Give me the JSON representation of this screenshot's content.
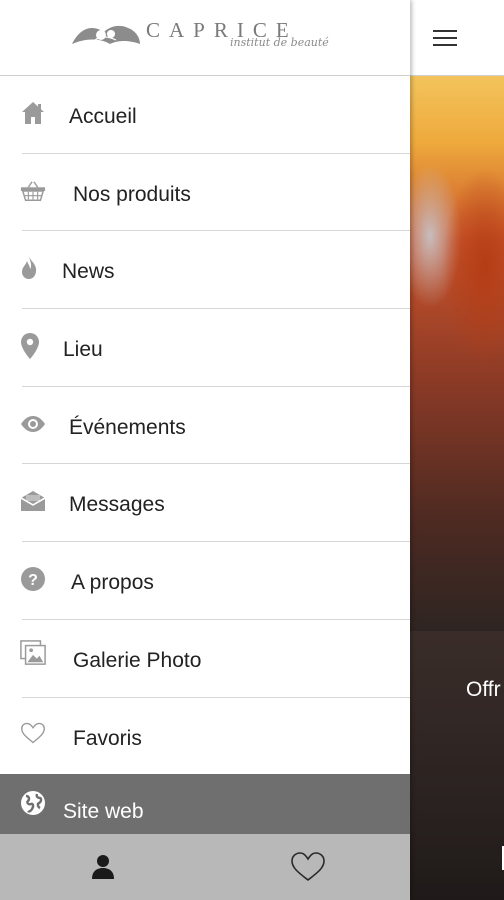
{
  "logo": {
    "name": "CAPRICE",
    "subtitle": "institut de beauté"
  },
  "menu": {
    "items": [
      {
        "label": "Accueil",
        "icon": "home-icon"
      },
      {
        "label": "Nos produits",
        "icon": "basket-icon"
      },
      {
        "label": "News",
        "icon": "flame-icon"
      },
      {
        "label": "Lieu",
        "icon": "location-pin-icon"
      },
      {
        "label": "Événements",
        "icon": "eye-icon"
      },
      {
        "label": "Messages",
        "icon": "envelope-icon"
      },
      {
        "label": "A propos",
        "icon": "question-icon"
      },
      {
        "label": "Galerie Photo",
        "icon": "photo-gallery-icon"
      },
      {
        "label": "Favoris",
        "icon": "heart-outline-icon"
      }
    ],
    "site_web": {
      "label": "Site web",
      "icon": "globe-icon"
    }
  },
  "tabbar": {
    "left_icon": "person-icon",
    "right_icon": "heart-outline-icon"
  },
  "main": {
    "offer_text": "Offr"
  },
  "colors": {
    "drawer_bg": "#ffffff",
    "icon_gray": "#9a9a9a",
    "site_web_bg": "#6f6f6f",
    "tabbar_bg": "#b8b8b8"
  }
}
